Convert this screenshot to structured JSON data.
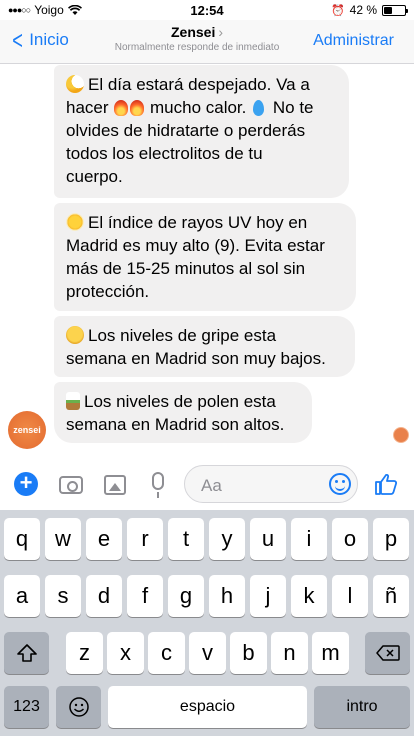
{
  "status_bar": {
    "carrier": "Yoigo",
    "time": "12:54",
    "battery": "42 %"
  },
  "nav": {
    "back_label": "Inicio",
    "title": "Zensei",
    "subtitle": "Normalmente responde de inmediato",
    "right_label": "Administrar"
  },
  "messages": [
    {
      "emoji": "sun-behind-cloud",
      "text_a": "El día estará despejado. Va a",
      "text_b": "hacer",
      "text_c": "mucho calor.",
      "text_d": "No te",
      "text_e": "olvides de hidratarte o perderás",
      "text_f": "todos los electrolitos de tu",
      "text_g": "cuerpo."
    },
    {
      "emoji": "sun",
      "line1": "El índice de rayos UV hoy en",
      "line2": "Madrid es muy alto (9). Evita estar",
      "line3": "más de 15-25 minutos al sol sin",
      "line4": "protección."
    },
    {
      "emoji": "sick-face",
      "line1": "Los niveles de gripe esta",
      "line2": "semana en Madrid son muy bajos."
    },
    {
      "emoji": "plant",
      "line1": "Los niveles de polen esta",
      "line2": "semana en Madrid son altos."
    }
  ],
  "avatar": {
    "label": "zensei"
  },
  "composer": {
    "placeholder": "Aa"
  },
  "keyboard": {
    "row1": [
      "q",
      "w",
      "e",
      "r",
      "t",
      "y",
      "u",
      "i",
      "o",
      "p"
    ],
    "row2": [
      "a",
      "s",
      "d",
      "f",
      "g",
      "h",
      "j",
      "k",
      "l",
      "ñ"
    ],
    "row3": [
      "z",
      "x",
      "c",
      "v",
      "b",
      "n",
      "m"
    ],
    "num_label": "123",
    "space_label": "espacio",
    "return_label": "intro"
  },
  "colors": {
    "accent": "#1a7cf6",
    "bubble": "#f1f0f0",
    "keyboard_bg": "#d1d5db"
  }
}
